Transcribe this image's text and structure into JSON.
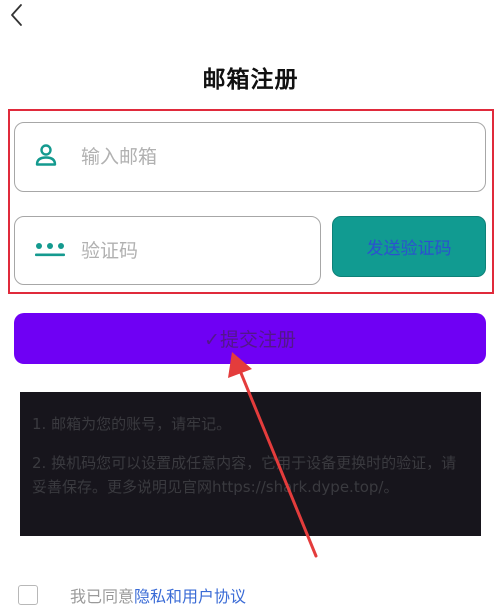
{
  "header": {
    "back_icon": "chevron-left-icon",
    "title": "邮箱注册"
  },
  "form": {
    "email": {
      "icon": "user-icon",
      "placeholder": "输入邮箱",
      "value": ""
    },
    "code": {
      "icon": "password-dots-icon",
      "placeholder": "验证码",
      "value": ""
    },
    "send_code_label": "发送验证码",
    "submit_label": "✓提交注册"
  },
  "notice": {
    "line1": "1. 邮箱为您的账号，请牢记。",
    "line2": "2. 换机码您可以设置成任意内容，它用于设备更换时的验证，请妥善保存。更多说明见官网https://shark.dype.top/。"
  },
  "agreement": {
    "checked": false,
    "text": "我已同意",
    "link_label": "隐私和用户协议"
  },
  "colors": {
    "highlight_border": "#e02a3b",
    "send_button_bg": "#119b91",
    "submit_button_bg": "#6f00f4",
    "notice_bg": "#17151c",
    "link": "#3a6bd6",
    "annotation_arrow": "#e43c3c"
  }
}
